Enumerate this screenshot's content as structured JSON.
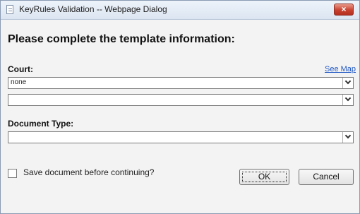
{
  "window": {
    "title": "KeyRules Validation -- Webpage Dialog",
    "close_label": "×"
  },
  "form": {
    "heading": "Please complete the template information:",
    "court_label": "Court:",
    "see_map_label": "See Map",
    "court_select_value": "none",
    "court_sub_select_value": "",
    "document_type_label": "Document Type:",
    "document_type_value": "",
    "save_checkbox_label": "Save document before continuing?",
    "save_checked": false
  },
  "buttons": {
    "ok_label": "OK",
    "cancel_label": "Cancel"
  }
}
